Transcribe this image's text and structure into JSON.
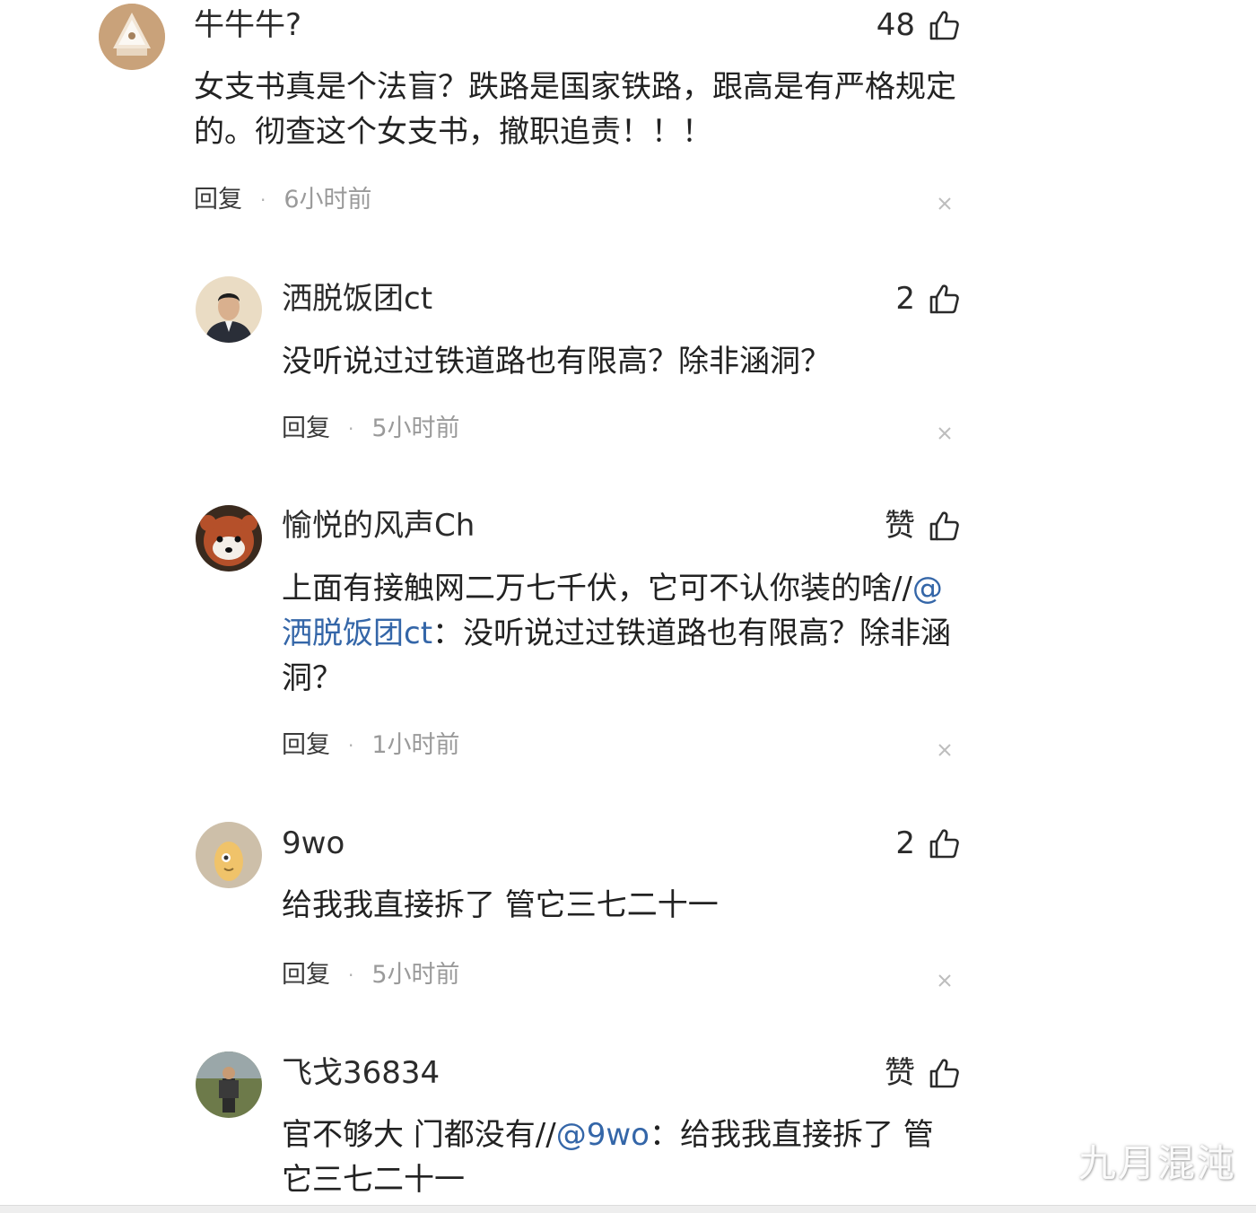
{
  "comments": [
    {
      "username": "牛牛牛?",
      "likes": "48",
      "text_lines": [
        "女支书真是个法盲？跌路是国家铁路，跟高是有严格规定",
        "的。彻查这个女支书，撤职追责！！！"
      ],
      "reply": "回复",
      "sep": "·",
      "time": "6小时前"
    },
    {
      "username": "洒脱饭团ct",
      "likes": "2",
      "text_lines": [
        "没听说过过铁道路也有限高？除非涵洞？"
      ],
      "reply": "回复",
      "sep": "·",
      "time": "5小时前"
    },
    {
      "username": "愉悦的风声Ch",
      "likes": "赞",
      "text_line1": "上面有接触网二万七千伏，它可不认你装的啥//",
      "text_line1_mention": "@",
      "text_line2_mention": "洒脱饭团ct",
      "text_line2": "：没听说过过铁道路也有限高？除非涵",
      "text_line3": "洞？",
      "reply": "回复",
      "sep": "·",
      "time": "1小时前"
    },
    {
      "username": "9wo",
      "likes": "2",
      "text_lines": [
        "给我我直接拆了 管它三七二十一"
      ],
      "reply": "回复",
      "sep": "·",
      "time": "5小时前"
    },
    {
      "username": "飞戈36834",
      "likes": "赞",
      "text_line1_pre": "官不够大 门都没有//",
      "text_line1_mention": "@9wo",
      "text_line1_post": "：给我我直接拆了 管",
      "text_line2": "它三七二十一"
    }
  ],
  "watermark": "九月混沌",
  "colors": {
    "mention": "#3466a8",
    "text": "#222222",
    "time": "#9a9a9a"
  }
}
